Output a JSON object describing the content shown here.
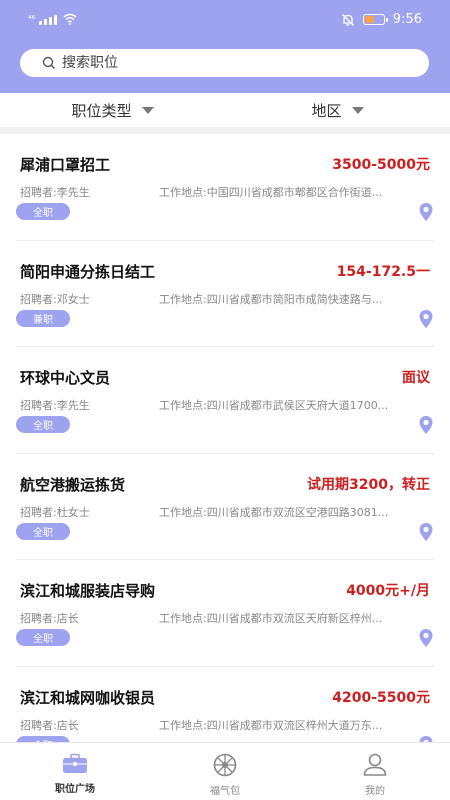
{
  "status": {
    "signal_label": "⁴⁶",
    "time": "9:56"
  },
  "search": {
    "placeholder": "搜索职位"
  },
  "filters": [
    {
      "label": "职位类型"
    },
    {
      "label": "地区"
    }
  ],
  "jobs": [
    {
      "title": "犀浦口罩招工",
      "salary": "3500-5000元",
      "recruiter": "招聘者:李先生",
      "location": "工作地点:中国四川省成都市郫都区合作街道...",
      "tag": "全职"
    },
    {
      "title": "简阳申通分拣日结工",
      "salary": "154-172.5一",
      "recruiter": "招聘者:邓女士",
      "location": "工作地点:四川省成都市简阳市成简快速路与...",
      "tag": "兼职"
    },
    {
      "title": "环球中心文员",
      "salary": "面议",
      "recruiter": "招聘者:李先生",
      "location": "工作地点:四川省成都市武侯区天府大道1700...",
      "tag": "全职"
    },
    {
      "title": "航空港搬运拣货",
      "salary": "试用期3200，转正",
      "recruiter": "招聘者:杜女士",
      "location": "工作地点:四川省成都市双流区空港四路3081...",
      "tag": "全职"
    },
    {
      "title": "滨江和城服装店导购",
      "salary": "4000元+/月",
      "recruiter": "招聘者:店长",
      "location": "工作地点:四川省成都市双流区天府新区梓州...",
      "tag": "全职"
    },
    {
      "title": "滨江和城网咖收银员",
      "salary": "4200-5500元",
      "recruiter": "招聘者:店长",
      "location": "工作地点:四川省成都市双流区梓州大道万东...",
      "tag": "全职"
    }
  ],
  "tabs": [
    {
      "label": "职位广场",
      "icon": "briefcase-icon"
    },
    {
      "label": "福气包",
      "icon": "wheel-icon"
    },
    {
      "label": "我的",
      "icon": "person-icon"
    }
  ],
  "colors": {
    "accent": "#9ea3ef",
    "salary": "#cc2020"
  }
}
